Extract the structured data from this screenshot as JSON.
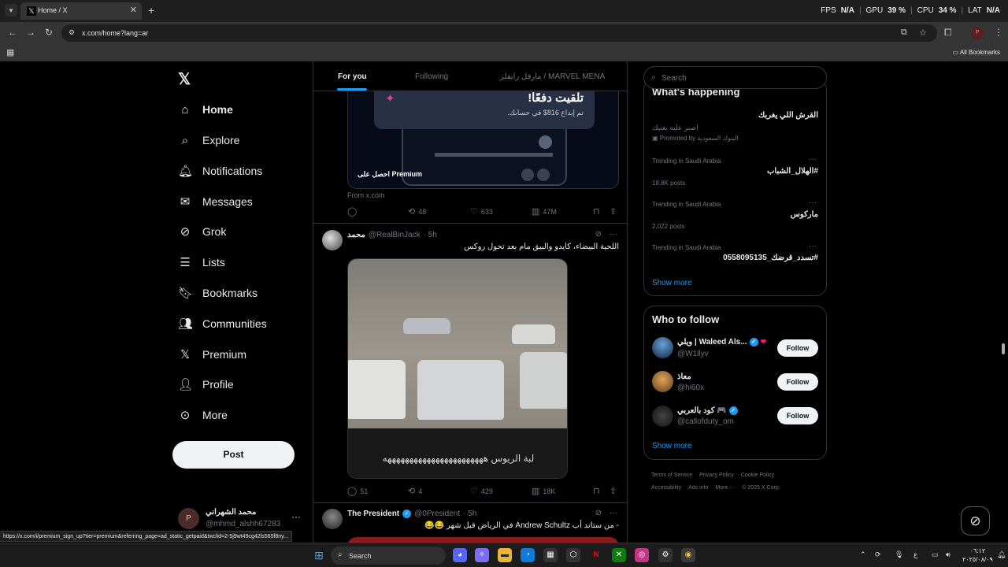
{
  "browser": {
    "tab_title": "Home / X",
    "url": "x.com/home?lang=ar",
    "all_bookmarks": "All Bookmarks",
    "profile_initial": "P",
    "status_url": "https://x.com/i/premium_sign_up?tier=premium&referring_page=ad_static_getpaid&twclid=2-5j9wt49cg42ls565f8ny..."
  },
  "hud": {
    "fps_label": "FPS",
    "fps_value": "N/A",
    "gpu_label": "GPU",
    "gpu_value": "39 %",
    "cpu_label": "CPU",
    "cpu_value": "34 %",
    "lat_label": "LAT",
    "lat_value": "N/A"
  },
  "nav": {
    "items": [
      {
        "label": "Home",
        "icon": "home-icon"
      },
      {
        "label": "Explore",
        "icon": "search-icon"
      },
      {
        "label": "Notifications",
        "icon": "bell-icon"
      },
      {
        "label": "Messages",
        "icon": "envelope-icon"
      },
      {
        "label": "Grok",
        "icon": "grok-icon"
      },
      {
        "label": "Lists",
        "icon": "list-icon"
      },
      {
        "label": "Bookmarks",
        "icon": "bookmark-icon"
      },
      {
        "label": "Communities",
        "icon": "people-icon"
      },
      {
        "label": "Premium",
        "icon": "x-icon"
      },
      {
        "label": "Profile",
        "icon": "person-icon"
      },
      {
        "label": "More",
        "icon": "more-circle-icon"
      }
    ],
    "post_label": "Post",
    "account": {
      "initial": "P",
      "name": "محمد الشهراني",
      "handle": "@mhmd_alshh67283"
    }
  },
  "feed": {
    "tabs": [
      "For you",
      "Following",
      "مارفل رايفلز / MARVEL MENA"
    ],
    "ad": {
      "headline": "تلقيت دفعًا!",
      "sub": "تم إيداع 816$ في حسابك.",
      "cta": "احصل على Premium",
      "from": "From x.com",
      "retweets": "48",
      "likes": "633",
      "views": "47M"
    },
    "tweet1": {
      "name": "محمد",
      "handle": "@RealBinJack",
      "time": "· 5h",
      "text": "اللحية البيضاء، كايدو والبيق مام بعد تحول روكس",
      "caption": "لبة الريوس هههههههههههههههههههههههه",
      "replies": "51",
      "retweets": "4",
      "likes": "429",
      "views": "18K"
    },
    "tweet2": {
      "name": "The President",
      "handle": "@0President",
      "time": "· 5h",
      "text": "- من ستاند أب Andrew Schultz في الرياض قبل شهر 😂😂"
    }
  },
  "sidebar": {
    "search_placeholder": "Search",
    "happening_title": "What's happening",
    "promo": {
      "title": "القرش اللي يغربك",
      "sub": "اصبر عليه يغنيك",
      "promoted": "Promoted by البنوك السعودية"
    },
    "trends": [
      {
        "context": "Trending in Saudi Arabia",
        "title": "#الهلال_الشباب",
        "count": "18.8K posts"
      },
      {
        "context": "Trending in Saudi Arabia",
        "title": "ماركوس",
        "count": "2,022 posts"
      },
      {
        "context": "Trending in Saudi Arabia",
        "title": "#تسدد_قرضك_0558095135",
        "count": ""
      }
    ],
    "show_more": "Show more",
    "who_to_follow": "Who to follow",
    "follows": [
      {
        "name": "ويلي | Waleed Als...",
        "handle": "@W1llyv",
        "button": "Follow"
      },
      {
        "name": "معاذ",
        "handle": "@hi60x",
        "button": "Follow"
      },
      {
        "name": "كود بالعربي 🎮",
        "handle": "@callofduty_om",
        "button": "Follow"
      }
    ],
    "footer": [
      "Terms of Service",
      "Privacy Policy",
      "Cookie Policy",
      "Accessibility",
      "Ads info",
      "More ···",
      "© 2025 X Corp."
    ]
  },
  "taskbar": {
    "search_label": "Search",
    "clock_time": "٠٦:١٢",
    "clock_date": "٢٠٢٥/٠٨/٠٩",
    "lang": "ع"
  },
  "colors": {
    "accent": "#1d9bf0",
    "bg": "#000000",
    "border": "#2f3336",
    "muted": "#71767b"
  }
}
